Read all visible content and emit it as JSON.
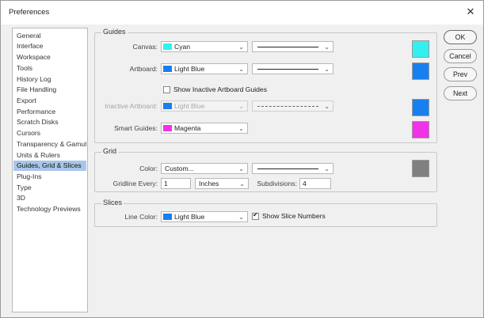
{
  "window": {
    "title": "Preferences",
    "close_glyph": "✕"
  },
  "sidebar": {
    "items": [
      {
        "label": "General"
      },
      {
        "label": "Interface"
      },
      {
        "label": "Workspace"
      },
      {
        "label": "Tools"
      },
      {
        "label": "History Log"
      },
      {
        "label": "File Handling"
      },
      {
        "label": "Export"
      },
      {
        "label": "Performance"
      },
      {
        "label": "Scratch Disks"
      },
      {
        "label": "Cursors"
      },
      {
        "label": "Transparency & Gamut"
      },
      {
        "label": "Units & Rulers"
      },
      {
        "label": "Guides, Grid & Slices",
        "selected": true
      },
      {
        "label": "Plug-Ins"
      },
      {
        "label": "Type"
      },
      {
        "label": "3D"
      },
      {
        "label": "Technology Previews"
      }
    ]
  },
  "guides": {
    "title": "Guides",
    "canvas": {
      "label": "Canvas:",
      "color_name": "Cyan",
      "color": "#33f0f0",
      "line_style": "solid"
    },
    "artboard": {
      "label": "Artboard:",
      "color_name": "Light Blue",
      "color": "#1a7fee",
      "line_style": "solid"
    },
    "show_inactive": {
      "label": "Show Inactive Artboard Guides",
      "checked": false
    },
    "inactive_artboard": {
      "label": "Inactive Artboard:",
      "color_name": "Light Blue",
      "color": "#1a7fee",
      "line_style": "dashed",
      "disabled": true
    },
    "smart_guides": {
      "label": "Smart Guides:",
      "color_name": "Magenta",
      "color": "#f033e8"
    }
  },
  "grid": {
    "title": "Grid",
    "color": {
      "label": "Color:",
      "value": "Custom...",
      "swatch": "#808080",
      "line_style": "solid"
    },
    "gridline_every": {
      "label": "Gridline Every:",
      "value": "1",
      "units": "Inches"
    },
    "subdivisions": {
      "label": "Subdivisions:",
      "value": "4"
    }
  },
  "slices": {
    "title": "Slices",
    "line_color": {
      "label": "Line Color:",
      "color_name": "Light Blue",
      "color": "#1a7fee"
    },
    "show_slice_numbers": {
      "label": "Show Slice Numbers",
      "checked": true
    }
  },
  "buttons": {
    "ok": "OK",
    "cancel": "Cancel",
    "prev": "Prev",
    "next": "Next"
  },
  "icons": {
    "chevron": "chevron-down-icon",
    "close": "close-icon"
  },
  "colors": {
    "selection_bg": "#a9c6e8",
    "dialog_bg": "#f0f0f0"
  }
}
